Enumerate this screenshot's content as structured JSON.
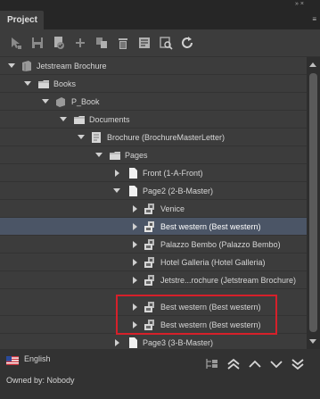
{
  "panel": {
    "tab_label": "Project",
    "window_controls": "» ×",
    "menu_glyph": "≡"
  },
  "toolbar": {
    "buttons": [
      "pointer-icon",
      "save-icon",
      "checkin-icon",
      "add-icon",
      "copy-icon",
      "delete-icon",
      "properties-icon",
      "preview-icon",
      "refresh-icon"
    ]
  },
  "tree": {
    "rows": [
      {
        "label": "Jetstream Brochure",
        "expanded": true,
        "icon": "book-icon"
      },
      {
        "label": "Books",
        "expanded": true,
        "icon": "folder-icon"
      },
      {
        "label": "P_Book",
        "expanded": true,
        "icon": "book-icon"
      },
      {
        "label": "Documents",
        "expanded": true,
        "icon": "folder-icon"
      },
      {
        "label": "Brochure (BrochureMasterLetter)",
        "expanded": true,
        "icon": "document-icon"
      },
      {
        "label": "Pages",
        "expanded": true,
        "icon": "folder-icon"
      },
      {
        "label": "Front (1-A-Front)",
        "expanded": false,
        "icon": "page-icon"
      },
      {
        "label": "Page2 (2-B-Master)",
        "expanded": true,
        "icon": "page-icon"
      },
      {
        "label": "Venice",
        "expanded": false,
        "icon": "component-icon"
      },
      {
        "label": "Best western (Best western)",
        "expanded": false,
        "icon": "component-icon",
        "selected": true
      },
      {
        "label": "Palazzo Bembo (Palazzo Bembo)",
        "expanded": false,
        "icon": "component-icon"
      },
      {
        "label": "Hotel Galleria (Hotel Galleria)",
        "expanded": false,
        "icon": "component-icon"
      },
      {
        "label": "Jetstre...rochure (Jetstream Brochure)",
        "expanded": false,
        "icon": "component-icon"
      },
      {
        "label": "Best western (Best western)",
        "expanded": false,
        "icon": "component-icon"
      },
      {
        "label": "Best western (Best western)",
        "expanded": false,
        "icon": "component-icon"
      },
      {
        "label": "Page3 (3-B-Master)",
        "expanded": false,
        "icon": "page-icon"
      }
    ]
  },
  "footer": {
    "language": "English",
    "owned_by": "Owned by: Nobody"
  },
  "colors": {
    "panel_bg": "#3c3c3c",
    "selection": "#4b5566",
    "highlight_box": "#d6202a"
  }
}
